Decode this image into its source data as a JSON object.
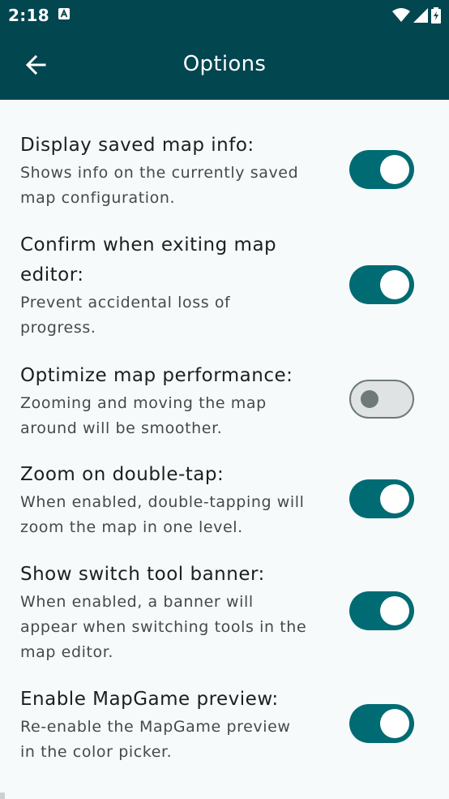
{
  "status_bar": {
    "time": "2:18",
    "icons": [
      "notification-a-icon",
      "wifi-icon",
      "signal-icon",
      "battery-icon"
    ]
  },
  "app_bar": {
    "title": "Options",
    "back_icon": "arrow-back-icon"
  },
  "options": [
    {
      "title_lines": [
        "Display saved map info:"
      ],
      "desc_lines": [
        "Shows info on the currently saved",
        "map configuration."
      ],
      "enabled": true
    },
    {
      "title_lines": [
        "Confirm when exiting map",
        "editor:"
      ],
      "desc_lines": [
        "Prevent accidental loss of",
        "progress."
      ],
      "enabled": true
    },
    {
      "title_lines": [
        "Optimize map performance:"
      ],
      "desc_lines": [
        "Zooming and moving the map",
        "around will be smoother."
      ],
      "enabled": false
    },
    {
      "title_lines": [
        "Zoom on double-tap:"
      ],
      "desc_lines": [
        "When enabled, double-tapping will",
        "zoom the map in one level."
      ],
      "enabled": true
    },
    {
      "title_lines": [
        "Show switch tool banner:"
      ],
      "desc_lines": [
        "When enabled, a banner will",
        "appear when switching tools in the",
        "map editor."
      ],
      "enabled": true
    },
    {
      "title_lines": [
        "Enable MapGame preview:"
      ],
      "desc_lines": [
        "Re-enable the MapGame preview",
        "in the color picker."
      ],
      "enabled": true
    }
  ],
  "colors": {
    "app_bar": "#024650",
    "switch_on": "#006b73",
    "switch_off_track": "#dfe3e4",
    "switch_off_outline": "#6f7979",
    "background": "#f6fafa"
  }
}
